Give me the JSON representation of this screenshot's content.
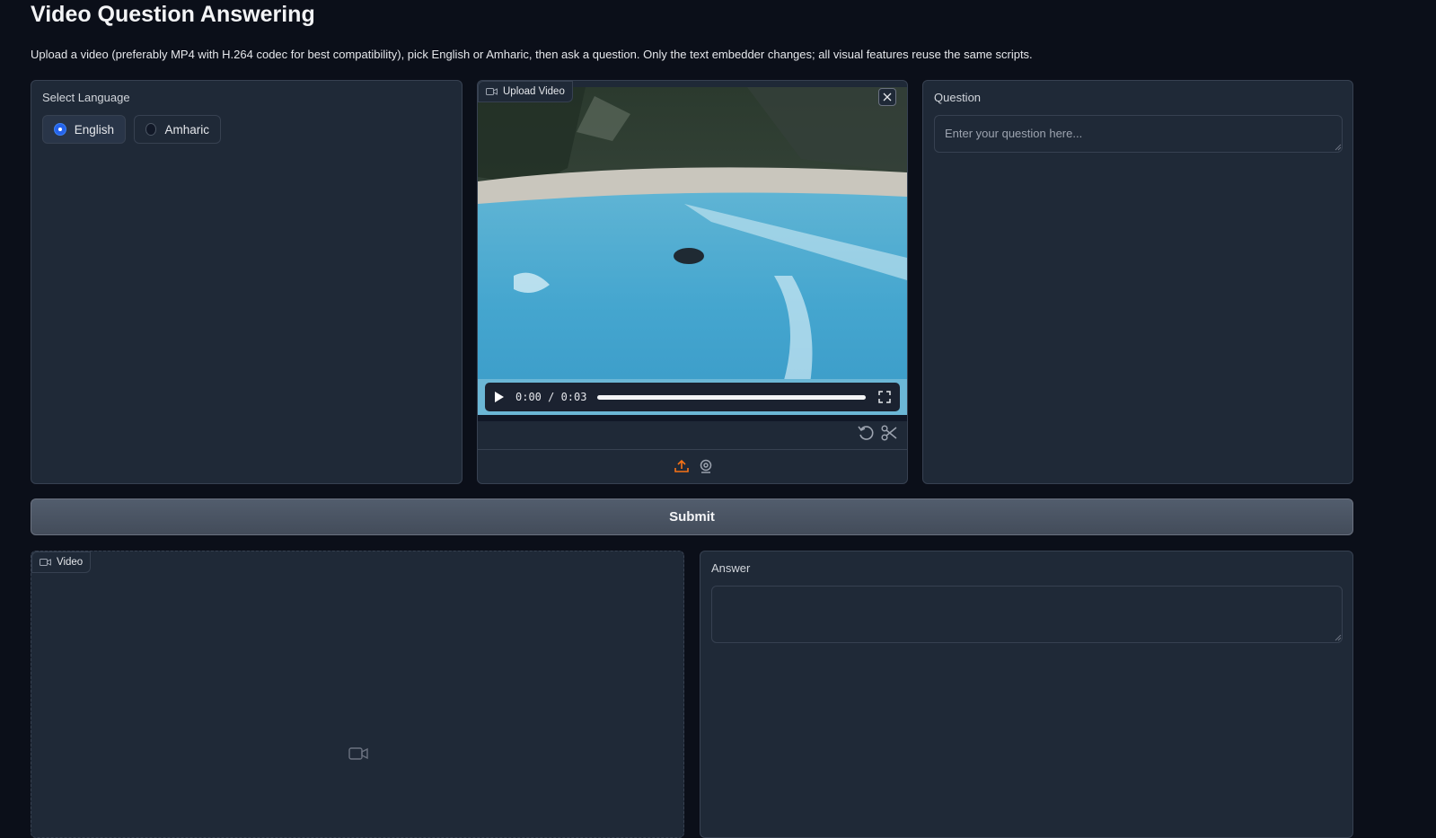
{
  "page": {
    "title": "Video Question Answering",
    "description": "Upload a video (preferably MP4 with H.264 codec for best compatibility), pick English or Amharic, then ask a question. Only the text embedder changes; all visual features reuse the same scripts."
  },
  "language": {
    "label": "Select Language",
    "options": [
      "English",
      "Amharic"
    ],
    "selected": "English"
  },
  "upload_video": {
    "label": "Upload Video",
    "player": {
      "current_time": "0:00",
      "duration": "0:03",
      "time_text": "0:00 / 0:03"
    },
    "icons": [
      "play-icon",
      "fullscreen-icon",
      "close-icon",
      "undo-icon",
      "scissors-icon",
      "upload-icon",
      "webcam-icon"
    ]
  },
  "question": {
    "label": "Question",
    "placeholder": "Enter your question here...",
    "value": ""
  },
  "submit": {
    "label": "Submit"
  },
  "output_video": {
    "label": "Video",
    "icon": "video-camera-icon"
  },
  "answer": {
    "label": "Answer",
    "value": ""
  },
  "colors": {
    "background": "#0b0f19",
    "panel": "#1f2937",
    "border": "#374151",
    "accent": "#2563eb",
    "upload_icon": "#f97316"
  }
}
